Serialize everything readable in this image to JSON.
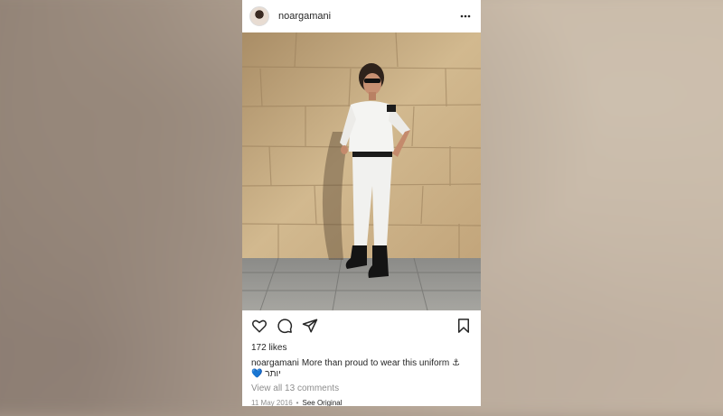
{
  "post": {
    "username": "noargamani",
    "likes": "172 likes",
    "caption_user": "noargamani",
    "caption_text": "More than proud to wear this uniform ⚓",
    "caption_line2_emoji": "💙",
    "caption_line2_text": "יותר",
    "view_comments": "View all 13 comments",
    "date": "11 May 2016",
    "separator": "•",
    "see_original": "See Original"
  },
  "icons": {
    "more": "more-horizontal-icon",
    "like": "heart-icon",
    "comment": "comment-bubble-icon",
    "share": "paper-plane-icon",
    "save": "bookmark-icon"
  },
  "colors": {
    "text": "#262626",
    "muted": "#8e8e8e",
    "heart_emoji": "#3a8dde"
  }
}
